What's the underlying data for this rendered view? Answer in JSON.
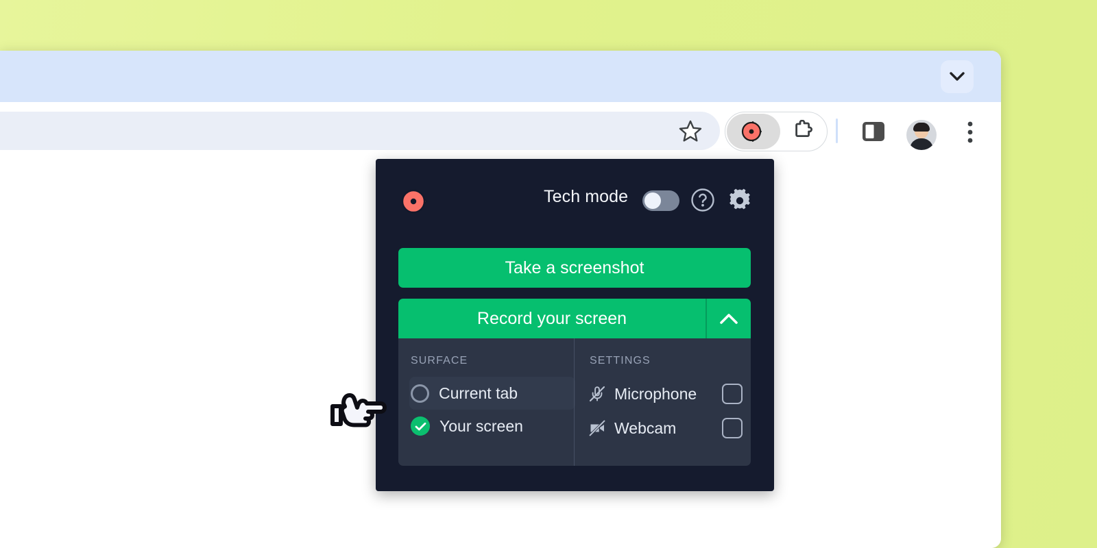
{
  "desktop": {
    "background_color": "#e4f490"
  },
  "browser": {
    "tabstrip": {
      "chevron_icon": "chevron-down-icon",
      "background_color": "#d7e5fb"
    },
    "toolbar": {
      "bookmark_icon": "star-icon",
      "extension_icon": "recorder-extension-icon",
      "puzzle_icon": "puzzle-piece-icon",
      "sidepanel_icon": "side-panel-icon",
      "avatar_icon": "user-avatar",
      "menu_icon": "three-dot-menu-icon"
    }
  },
  "popup": {
    "background_color": "#151b2e",
    "logo_icon": "recorder-logo-icon",
    "tech_mode_label": "Tech mode",
    "tech_mode_enabled": false,
    "help_icon": "help-circle-icon",
    "settings_icon": "gear-icon",
    "screenshot_button_label": "Take a screenshot",
    "record_button_label": "Record your screen",
    "record_chevron_icon": "chevron-up-icon",
    "accent_color": "#06bf6f",
    "surface": {
      "title": "SURFACE",
      "options": [
        {
          "label": "Current tab",
          "selected": false
        },
        {
          "label": "Your screen",
          "selected": true
        }
      ]
    },
    "settings": {
      "title": "SETTINGS",
      "options": [
        {
          "label": "Microphone",
          "icon": "microphone-muted-icon",
          "checked": false
        },
        {
          "label": "Webcam",
          "icon": "webcam-muted-icon",
          "checked": false
        }
      ]
    }
  },
  "annotation": {
    "cursor_icon": "pointing-hand-cursor"
  }
}
